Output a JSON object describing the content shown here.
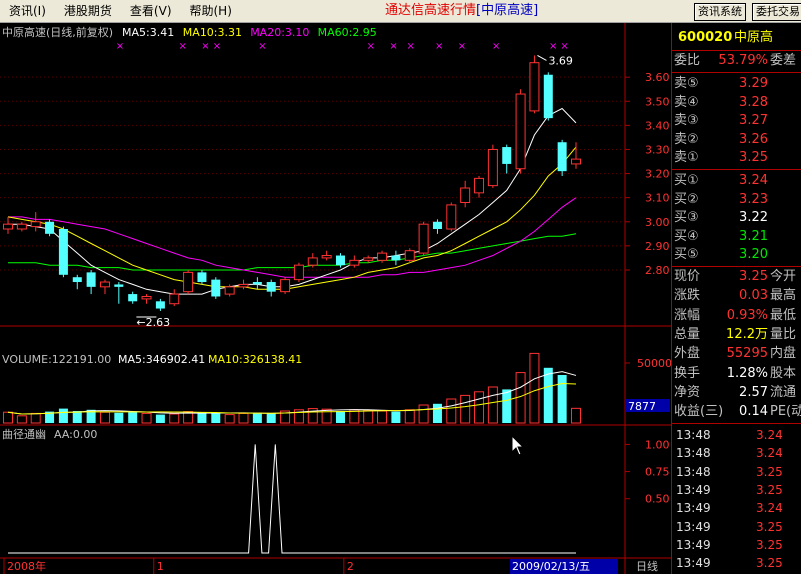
{
  "menu": {
    "items": [
      "资讯(I)",
      "港股期货",
      "查看(V)",
      "帮助(H)"
    ],
    "title": "通达信高速行情",
    "title_stock": "[中原高速]",
    "buttons": [
      "资讯系统",
      "委托交易"
    ]
  },
  "colors": {
    "up": "#ff3232",
    "down": "#54ffff",
    "ma5": "#ffffff",
    "ma10": "#ffff00",
    "ma20": "#ff00ff",
    "ma60": "#00ff00",
    "axis": "#b00000"
  },
  "chart_data": [
    {
      "type": "candlestick",
      "title": "中原高速(日线,前复权)",
      "indicators": [
        {
          "name": "MA5",
          "label": "MA5:3.41",
          "color": "#ffffff"
        },
        {
          "name": "MA10",
          "label": "MA10:3.31",
          "color": "#ffff00"
        },
        {
          "name": "MA20",
          "label": "MA20:3.10",
          "color": "#ff00ff"
        },
        {
          "name": "MA60",
          "label": "MA60:2.95",
          "color": "#00ff00"
        }
      ],
      "y_ticks": [
        "3.60",
        "3.50",
        "3.40",
        "3.30",
        "3.20",
        "3.10",
        "3.00",
        "2.90",
        "2.80"
      ],
      "ylim": [
        2.58,
        3.75
      ],
      "annotations": {
        "high": "3.69",
        "low": "2.63"
      },
      "candles": [
        {
          "o": 2.97,
          "c": 2.99,
          "h": 3.02,
          "l": 2.95
        },
        {
          "o": 2.97,
          "c": 2.99,
          "h": 3.0,
          "l": 2.96
        },
        {
          "o": 2.98,
          "c": 3.0,
          "h": 3.04,
          "l": 2.96
        },
        {
          "o": 3.0,
          "c": 2.95,
          "h": 3.01,
          "l": 2.94
        },
        {
          "o": 2.97,
          "c": 2.78,
          "h": 2.98,
          "l": 2.77
        },
        {
          "o": 2.77,
          "c": 2.75,
          "h": 2.78,
          "l": 2.72
        },
        {
          "o": 2.79,
          "c": 2.73,
          "h": 2.8,
          "l": 2.7
        },
        {
          "o": 2.73,
          "c": 2.75,
          "h": 2.76,
          "l": 2.7
        },
        {
          "o": 2.74,
          "c": 2.73,
          "h": 2.75,
          "l": 2.66
        },
        {
          "o": 2.7,
          "c": 2.67,
          "h": 2.71,
          "l": 2.66
        },
        {
          "o": 2.68,
          "c": 2.69,
          "h": 2.7,
          "l": 2.66
        },
        {
          "o": 2.67,
          "c": 2.64,
          "h": 2.68,
          "l": 2.63
        },
        {
          "o": 2.66,
          "c": 2.7,
          "h": 2.72,
          "l": 2.65
        },
        {
          "o": 2.71,
          "c": 2.79,
          "h": 2.8,
          "l": 2.7
        },
        {
          "o": 2.79,
          "c": 2.75,
          "h": 2.8,
          "l": 2.74
        },
        {
          "o": 2.76,
          "c": 2.69,
          "h": 2.77,
          "l": 2.68
        },
        {
          "o": 2.7,
          "c": 2.73,
          "h": 2.74,
          "l": 2.69
        },
        {
          "o": 2.73,
          "c": 2.74,
          "h": 2.76,
          "l": 2.72
        },
        {
          "o": 2.75,
          "c": 2.74,
          "h": 2.77,
          "l": 2.72
        },
        {
          "o": 2.75,
          "c": 2.71,
          "h": 2.76,
          "l": 2.69
        },
        {
          "o": 2.71,
          "c": 2.76,
          "h": 2.77,
          "l": 2.7
        },
        {
          "o": 2.76,
          "c": 2.82,
          "h": 2.83,
          "l": 2.75
        },
        {
          "o": 2.82,
          "c": 2.85,
          "h": 2.87,
          "l": 2.81
        },
        {
          "o": 2.85,
          "c": 2.86,
          "h": 2.88,
          "l": 2.84
        },
        {
          "o": 2.86,
          "c": 2.82,
          "h": 2.87,
          "l": 2.81
        },
        {
          "o": 2.82,
          "c": 2.84,
          "h": 2.86,
          "l": 2.81
        },
        {
          "o": 2.84,
          "c": 2.85,
          "h": 2.86,
          "l": 2.83
        },
        {
          "o": 2.84,
          "c": 2.87,
          "h": 2.88,
          "l": 2.83
        },
        {
          "o": 2.86,
          "c": 2.84,
          "h": 2.88,
          "l": 2.82
        },
        {
          "o": 2.84,
          "c": 2.88,
          "h": 2.89,
          "l": 2.83
        },
        {
          "o": 2.87,
          "c": 2.99,
          "h": 3.0,
          "l": 2.86
        },
        {
          "o": 3.0,
          "c": 2.97,
          "h": 3.01,
          "l": 2.95
        },
        {
          "o": 2.97,
          "c": 3.07,
          "h": 3.08,
          "l": 2.96
        },
        {
          "o": 3.08,
          "c": 3.14,
          "h": 3.17,
          "l": 3.06
        },
        {
          "o": 3.12,
          "c": 3.18,
          "h": 3.19,
          "l": 3.1
        },
        {
          "o": 3.15,
          "c": 3.3,
          "h": 3.32,
          "l": 3.14
        },
        {
          "o": 3.31,
          "c": 3.24,
          "h": 3.32,
          "l": 3.2
        },
        {
          "o": 3.22,
          "c": 3.53,
          "h": 3.55,
          "l": 3.2
        },
        {
          "o": 3.46,
          "c": 3.66,
          "h": 3.69,
          "l": 3.45
        },
        {
          "o": 3.61,
          "c": 3.43,
          "h": 3.62,
          "l": 3.42
        },
        {
          "o": 3.33,
          "c": 3.21,
          "h": 3.34,
          "l": 3.19
        },
        {
          "o": 3.24,
          "c": 3.26,
          "h": 3.33,
          "l": 3.22
        }
      ],
      "ma5": [
        2.99,
        2.99,
        2.98,
        2.97,
        2.92,
        2.87,
        2.82,
        2.79,
        2.76,
        2.74,
        2.72,
        2.71,
        2.7,
        2.7,
        2.7,
        2.72,
        2.73,
        2.74,
        2.74,
        2.73,
        2.73,
        2.74,
        2.76,
        2.78,
        2.8,
        2.83,
        2.85,
        2.85,
        2.86,
        2.87,
        2.88,
        2.91,
        2.95,
        2.99,
        3.03,
        3.08,
        3.13,
        3.22,
        3.36,
        3.44,
        3.47,
        3.41
      ],
      "ma10": [
        3.02,
        3.01,
        3.0,
        2.99,
        2.97,
        2.94,
        2.91,
        2.88,
        2.85,
        2.82,
        2.8,
        2.78,
        2.76,
        2.75,
        2.74,
        2.73,
        2.73,
        2.73,
        2.72,
        2.72,
        2.72,
        2.73,
        2.74,
        2.75,
        2.76,
        2.77,
        2.79,
        2.8,
        2.81,
        2.83,
        2.85,
        2.86,
        2.88,
        2.91,
        2.94,
        2.97,
        3.0,
        3.05,
        3.11,
        3.19,
        3.24,
        3.31
      ],
      "ma20": [
        3.02,
        3.02,
        3.01,
        3.01,
        3.0,
        2.99,
        2.98,
        2.97,
        2.95,
        2.93,
        2.91,
        2.89,
        2.87,
        2.85,
        2.84,
        2.82,
        2.81,
        2.8,
        2.79,
        2.78,
        2.77,
        2.77,
        2.77,
        2.77,
        2.77,
        2.77,
        2.77,
        2.78,
        2.78,
        2.79,
        2.79,
        2.8,
        2.81,
        2.82,
        2.84,
        2.86,
        2.89,
        2.92,
        2.96,
        3.01,
        3.06,
        3.1
      ],
      "ma60": [
        2.83,
        2.83,
        2.83,
        2.82,
        2.82,
        2.82,
        2.81,
        2.81,
        2.81,
        2.8,
        2.8,
        2.8,
        2.8,
        2.8,
        2.8,
        2.8,
        2.8,
        2.8,
        2.81,
        2.81,
        2.81,
        2.81,
        2.82,
        2.82,
        2.82,
        2.83,
        2.83,
        2.84,
        2.84,
        2.85,
        2.86,
        2.87,
        2.87,
        2.88,
        2.89,
        2.9,
        2.91,
        2.92,
        2.93,
        2.94,
        2.94,
        2.95
      ]
    },
    {
      "type": "bar",
      "title": "VOLUME:122191.00",
      "indicators": [
        {
          "name": "MA5",
          "label": "MA5:346902.41",
          "color": "#ffffff"
        },
        {
          "name": "MA10",
          "label": "MA10:326138.41",
          "color": "#ffff00"
        }
      ],
      "y_ticks": [
        "50000"
      ],
      "side_label": "7877",
      "ylim": [
        0,
        650000
      ],
      "values": [
        90000,
        60000,
        80000,
        95000,
        120000,
        100000,
        110000,
        90000,
        85000,
        95000,
        80000,
        70000,
        75000,
        95000,
        90000,
        85000,
        70000,
        80000,
        85000,
        80000,
        100000,
        110000,
        120000,
        115000,
        100000,
        110000,
        105000,
        100000,
        95000,
        110000,
        150000,
        160000,
        200000,
        230000,
        260000,
        300000,
        280000,
        420000,
        580000,
        460000,
        400000,
        122191
      ]
    },
    {
      "type": "line",
      "title": "曲径通幽",
      "indicators": [
        {
          "name": "AA",
          "label": "AA:0.00",
          "color": "#ffffff"
        }
      ],
      "y_ticks": [
        "1.00",
        "0.75",
        "0.50"
      ],
      "ylim": [
        0,
        1.05
      ],
      "values": [
        0,
        0,
        0,
        0,
        0,
        0,
        0,
        0,
        0,
        0,
        0,
        0,
        0,
        0,
        0,
        0,
        0,
        0,
        0,
        0,
        0,
        0,
        0,
        0,
        0,
        0,
        0,
        0,
        0,
        0,
        0,
        0,
        0,
        0,
        0,
        0,
        0,
        1,
        0,
        0,
        1,
        0,
        0,
        0,
        0,
        0,
        0,
        0,
        0,
        0,
        0,
        0,
        0,
        0,
        0,
        0,
        0,
        0,
        0,
        0,
        0,
        0,
        0,
        0,
        0,
        0,
        0,
        0,
        0,
        0,
        0,
        0,
        0,
        0,
        0,
        0,
        0,
        0,
        0,
        0,
        0,
        0,
        0,
        0,
        0,
        0
      ],
      "x_labels": [
        {
          "text": "2008年",
          "at": 0
        },
        {
          "text": "1",
          "at": 0.26
        },
        {
          "text": "2",
          "at": 0.59
        }
      ],
      "date_label": "2009/02/13/五",
      "period_label": "日线"
    }
  ],
  "quote": {
    "code": "600020",
    "name": "中原高",
    "weibi_label": "委比",
    "weibi_value": "53.79%",
    "weicha_label": "委差",
    "asks": [
      {
        "label": "卖⑤",
        "price": "3.29"
      },
      {
        "label": "卖④",
        "price": "3.28"
      },
      {
        "label": "卖③",
        "price": "3.27"
      },
      {
        "label": "卖②",
        "price": "3.26"
      },
      {
        "label": "卖①",
        "price": "3.25"
      }
    ],
    "bids": [
      {
        "label": "买①",
        "price": "3.24",
        "cls": "red"
      },
      {
        "label": "买②",
        "price": "3.23",
        "cls": "red"
      },
      {
        "label": "买③",
        "price": "3.22",
        "cls": "white"
      },
      {
        "label": "买④",
        "price": "3.21",
        "cls": "green"
      },
      {
        "label": "买⑤",
        "price": "3.20",
        "cls": "green"
      }
    ],
    "stats": [
      {
        "label": "现价",
        "value": "3.25",
        "cls": "red",
        "right": "今开"
      },
      {
        "label": "涨跌",
        "value": "0.03",
        "cls": "red",
        "right": "最高"
      },
      {
        "label": "涨幅",
        "value": "0.93%",
        "cls": "red",
        "right": "最低"
      },
      {
        "label": "总量",
        "value": "12.2万",
        "cls": "yellow",
        "right": "量比"
      },
      {
        "label": "外盘",
        "value": "55295",
        "cls": "red",
        "right": "内盘"
      },
      {
        "label": "换手",
        "value": "1.28%",
        "cls": "white",
        "right": "股本"
      },
      {
        "label": "净资",
        "value": "2.57",
        "cls": "white",
        "right": "流通"
      },
      {
        "label": "收益(三)",
        "value": "0.14",
        "cls": "white",
        "right": "PE(动"
      }
    ],
    "ticks": [
      {
        "time": "13:48",
        "price": "3.24"
      },
      {
        "time": "13:48",
        "price": "3.24"
      },
      {
        "time": "13:48",
        "price": "3.25"
      },
      {
        "time": "13:49",
        "price": "3.25"
      },
      {
        "time": "13:49",
        "price": "3.24"
      },
      {
        "time": "13:49",
        "price": "3.25"
      },
      {
        "time": "13:49",
        "price": "3.25"
      },
      {
        "time": "13:49",
        "price": "3.25"
      }
    ]
  }
}
